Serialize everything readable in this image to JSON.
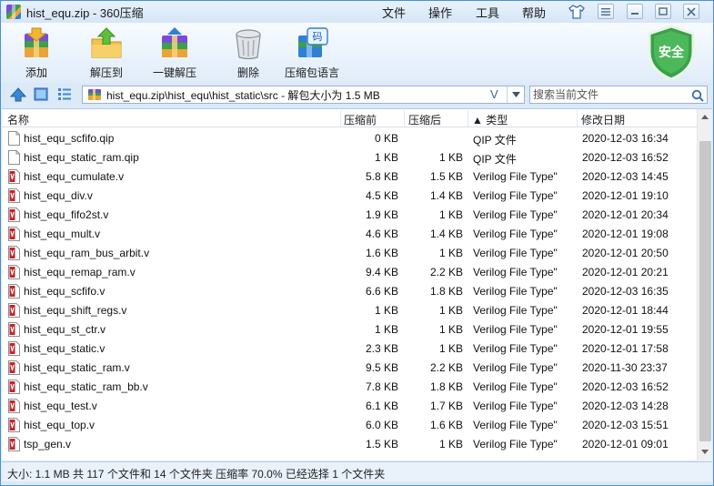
{
  "window": {
    "title": "hist_equ.zip - 360压缩",
    "menu": [
      "文件",
      "操作",
      "工具",
      "帮助"
    ]
  },
  "toolbar": {
    "items": [
      {
        "label": "添加",
        "icon": "add-archive-icon"
      },
      {
        "label": "解压到",
        "icon": "extract-to-icon"
      },
      {
        "label": "一键解压",
        "icon": "one-click-extract-icon"
      },
      {
        "label": "删除",
        "icon": "trash-icon"
      },
      {
        "label": "压缩包语言",
        "icon": "archive-language-icon"
      }
    ],
    "language_badge": "码",
    "security_badge": "安全"
  },
  "address": {
    "path": "hist_equ.zip\\hist_equ\\hist_static\\src - 解包大小为 1.5 MB",
    "search_placeholder": "搜索当前文件"
  },
  "columns": {
    "name": "名称",
    "compressed": "压缩前",
    "original": "压缩后",
    "type": "▲ 类型",
    "date": "修改日期"
  },
  "files": [
    {
      "name": "hist_equ_scfifo.qip",
      "compressed": "0 KB",
      "original": "",
      "type": "QIP 文件",
      "date": "2020-12-03 16:34",
      "kind": "qip"
    },
    {
      "name": "hist_equ_static_ram.qip",
      "compressed": "1 KB",
      "original": "1 KB",
      "type": "QIP 文件",
      "date": "2020-12-03 16:52",
      "kind": "qip"
    },
    {
      "name": "hist_equ_cumulate.v",
      "compressed": "5.8 KB",
      "original": "1.5 KB",
      "type": "Verilog File Type\"",
      "date": "2020-12-03 14:45",
      "kind": "v"
    },
    {
      "name": "hist_equ_div.v",
      "compressed": "4.5 KB",
      "original": "1.4 KB",
      "type": "Verilog File Type\"",
      "date": "2020-12-01 19:10",
      "kind": "v"
    },
    {
      "name": "hist_equ_fifo2st.v",
      "compressed": "1.9 KB",
      "original": "1 KB",
      "type": "Verilog File Type\"",
      "date": "2020-12-01 20:34",
      "kind": "v"
    },
    {
      "name": "hist_equ_mult.v",
      "compressed": "4.6 KB",
      "original": "1.4 KB",
      "type": "Verilog File Type\"",
      "date": "2020-12-01 19:08",
      "kind": "v"
    },
    {
      "name": "hist_equ_ram_bus_arbit.v",
      "compressed": "1.6 KB",
      "original": "1 KB",
      "type": "Verilog File Type\"",
      "date": "2020-12-01 20:50",
      "kind": "v"
    },
    {
      "name": "hist_equ_remap_ram.v",
      "compressed": "9.4 KB",
      "original": "2.2 KB",
      "type": "Verilog File Type\"",
      "date": "2020-12-01 20:21",
      "kind": "v"
    },
    {
      "name": "hist_equ_scfifo.v",
      "compressed": "6.6 KB",
      "original": "1.8 KB",
      "type": "Verilog File Type\"",
      "date": "2020-12-03 16:35",
      "kind": "v"
    },
    {
      "name": "hist_equ_shift_regs.v",
      "compressed": "1 KB",
      "original": "1 KB",
      "type": "Verilog File Type\"",
      "date": "2020-12-01 18:44",
      "kind": "v"
    },
    {
      "name": "hist_equ_st_ctr.v",
      "compressed": "1 KB",
      "original": "1 KB",
      "type": "Verilog File Type\"",
      "date": "2020-12-01 19:55",
      "kind": "v"
    },
    {
      "name": "hist_equ_static.v",
      "compressed": "2.3 KB",
      "original": "1 KB",
      "type": "Verilog File Type\"",
      "date": "2020-12-01 17:58",
      "kind": "v"
    },
    {
      "name": "hist_equ_static_ram.v",
      "compressed": "9.5 KB",
      "original": "2.2 KB",
      "type": "Verilog File Type\"",
      "date": "2020-11-30 23:37",
      "kind": "v"
    },
    {
      "name": "hist_equ_static_ram_bb.v",
      "compressed": "7.8 KB",
      "original": "1.8 KB",
      "type": "Verilog File Type\"",
      "date": "2020-12-03 16:52",
      "kind": "v"
    },
    {
      "name": "hist_equ_test.v",
      "compressed": "6.1 KB",
      "original": "1.7 KB",
      "type": "Verilog File Type\"",
      "date": "2020-12-03 14:28",
      "kind": "v"
    },
    {
      "name": "hist_equ_top.v",
      "compressed": "6.0 KB",
      "original": "1.6 KB",
      "type": "Verilog File Type\"",
      "date": "2020-12-03 15:51",
      "kind": "v"
    },
    {
      "name": "tsp_gen.v",
      "compressed": "1.5 KB",
      "original": "1 KB",
      "type": "Verilog File Type\"",
      "date": "2020-12-01 09:01",
      "kind": "v"
    }
  ],
  "status": {
    "text": "大小: 1.1 MB 共 117 个文件和 14 个文件夹 压缩率 70.0% 已经选择 1 个文件夹"
  },
  "colors": {
    "accent": "#2f7fd4",
    "shield": "#3aa04b",
    "verilog_icon": "#c0262c"
  }
}
